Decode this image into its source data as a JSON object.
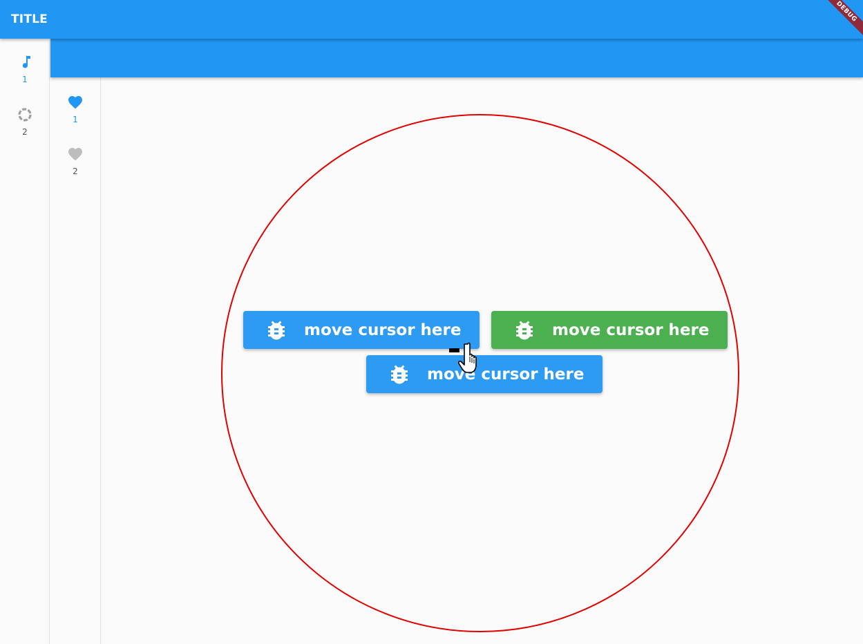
{
  "appbar": {
    "title": "TITLE",
    "debug_banner": "DEBUG"
  },
  "colors": {
    "primary": "#2196f3",
    "button_blue": "#2e9bf2",
    "button_green": "#4caf50",
    "circle": "#e00000"
  },
  "outer_rail": {
    "items": [
      {
        "icon": "music-note-icon",
        "label": "1",
        "selected": true
      },
      {
        "icon": "loading-ring-icon",
        "label": "2",
        "selected": false
      }
    ]
  },
  "inner_rail": {
    "items": [
      {
        "icon": "heart-icon",
        "label": "1",
        "selected": true
      },
      {
        "icon": "heart-icon",
        "label": "2",
        "selected": false
      }
    ]
  },
  "buttons": [
    {
      "label": "move cursor here",
      "color": "blue",
      "icon": "bug-icon"
    },
    {
      "label": "move cursor here",
      "color": "green",
      "icon": "bug-icon"
    },
    {
      "label": "move cursor here",
      "color": "blue",
      "icon": "bug-icon"
    }
  ]
}
